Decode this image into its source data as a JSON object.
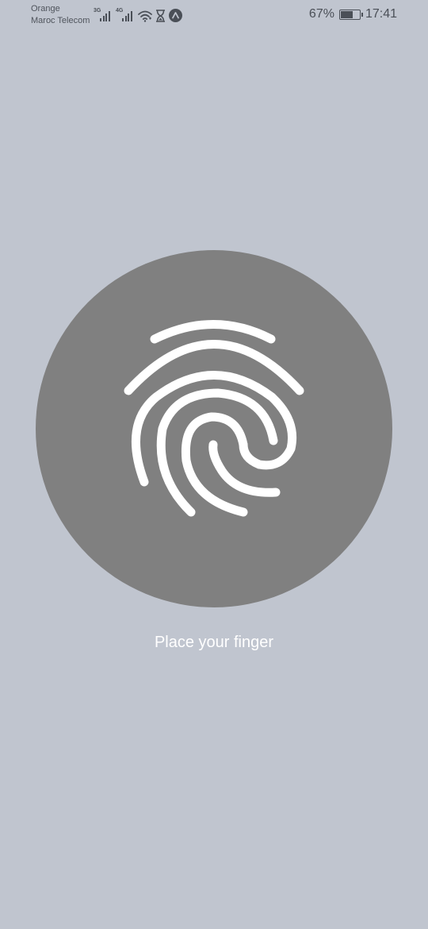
{
  "status_bar": {
    "carrier_line1": "Orange",
    "carrier_line2": "Maroc Telecom",
    "sim1_type": "3G",
    "sim2_type": "4G",
    "battery_percent": "67%",
    "battery_level": 0.67,
    "time": "17:41",
    "icons": [
      "signal-icon",
      "signal-icon",
      "wifi-icon",
      "hourglass-icon",
      "app-icon"
    ]
  },
  "fingerprint": {
    "icon": "fingerprint-icon",
    "circle_color": "#808080",
    "background_color": "#c0c5cf",
    "prompt": "Place your finger"
  }
}
